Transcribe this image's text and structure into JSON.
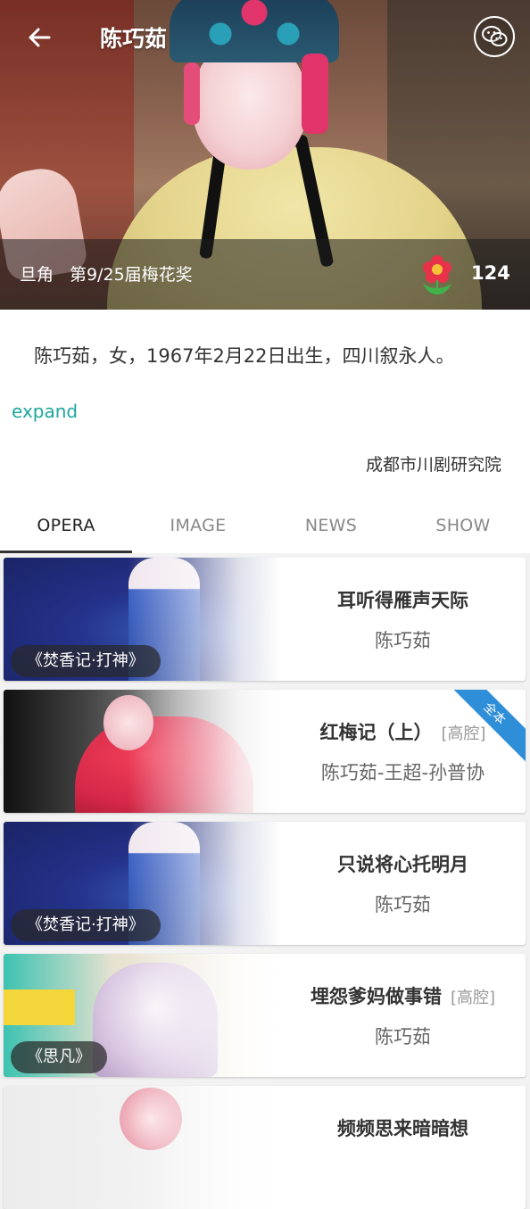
{
  "header": {
    "title": "陈巧茹",
    "back_icon": "arrow-left-icon",
    "share_icon": "wechat-icon"
  },
  "hero": {
    "role": "旦角",
    "award": "第9/25届梅花奖",
    "flower_icon": "flower-icon",
    "flower_count": "124"
  },
  "profile": {
    "bio": "陈巧茹，女，1967年2月22日出生，四川叙永人。",
    "expand_label": "expand",
    "organization": "成都市川剧研究院"
  },
  "tabs": [
    {
      "label": "OPERA",
      "active": true
    },
    {
      "label": "IMAGE",
      "active": false
    },
    {
      "label": "NEWS",
      "active": false
    },
    {
      "label": "SHOW",
      "active": false
    }
  ],
  "cards": [
    {
      "title": "耳听得雁声天际",
      "genre": "",
      "performers": "陈巧茹",
      "tag": "《焚香记·打神》",
      "corner": ""
    },
    {
      "title": "红梅记（上）",
      "genre": "[高腔]",
      "performers": "陈巧茹-王超-孙普协",
      "tag": "",
      "corner": "全本"
    },
    {
      "title": "只说将心托明月",
      "genre": "",
      "performers": "陈巧茹",
      "tag": "《焚香记·打神》",
      "corner": ""
    },
    {
      "title": "埋怨爹妈做事错",
      "genre": "[高腔]",
      "performers": "陈巧茹",
      "tag": "《思凡》",
      "corner": ""
    },
    {
      "title": "频频思来暗暗想",
      "genre": "",
      "performers": "",
      "tag": "",
      "corner": ""
    }
  ],
  "colors": {
    "accent": "#1ca79c",
    "corner_badge": "#2f8ed8"
  }
}
